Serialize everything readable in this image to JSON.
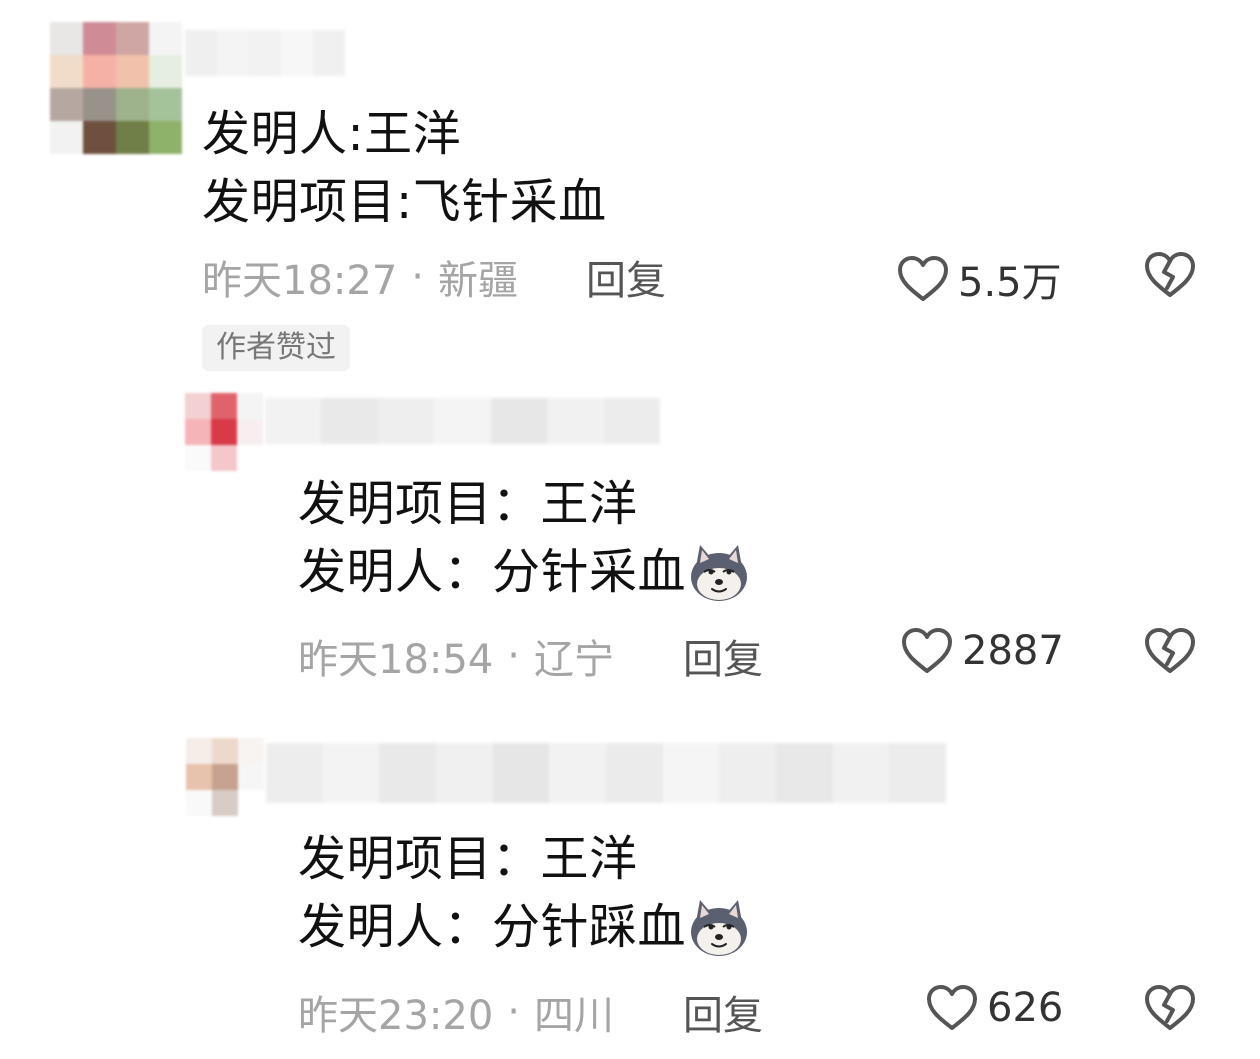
{
  "comments": [
    {
      "text_lines": [
        "发明人:王洋",
        "发明项目:飞针采血"
      ],
      "time": "昨天18:27",
      "location": "新疆",
      "separator": "·",
      "reply_label": "回复",
      "likes": "5.5万",
      "author_badge": "作者赞过",
      "avatar_colors": [
        "#e9e6e6",
        "#cf8c97",
        "#cfa6a3",
        "#f4f4f4",
        "#f1dcc9",
        "#f6b1a6",
        "#f1c2ab",
        "#e5eee0",
        "#b6a8a0",
        "#98928a",
        "#9eb28c",
        "#a4c39a",
        "#f2f2f2",
        "#6f503f",
        "#6f7f47",
        "#8fb26a"
      ],
      "name_colors": [
        "#efefef",
        "#f4f4f4",
        "#f2f2f2",
        "#f7f7f7",
        "#f0f0f0"
      ]
    },
    {
      "text_lines": [
        "发明项目：王洋",
        "发明人：分针采血"
      ],
      "time": "昨天18:54",
      "location": "辽宁",
      "separator": "·",
      "reply_label": "回复",
      "likes": "2887",
      "has_emoji": true,
      "emoji_icon": "doge-dog-emoji",
      "avatar_colors": [
        "#f3d0d2",
        "#e0626b",
        "#f4f4f4",
        "#f5b4b8",
        "#d83a48",
        "#f7efef",
        "#fafafa",
        "#f4c7cb",
        "#ffffff"
      ],
      "name_colors": [
        "#f2f2f2",
        "#e9e9e9",
        "#eeeeee",
        "#f4f4f4",
        "#e7e7e7",
        "#f1f1f1",
        "#ececec"
      ]
    },
    {
      "text_lines": [
        "发明项目：王洋",
        "发明人：分针踩血"
      ],
      "time": "昨天23:20",
      "location": "四川",
      "separator": "·",
      "reply_label": "回复",
      "likes": "626",
      "has_emoji": true,
      "emoji_icon": "doge-dog-emoji",
      "avatar_colors": [
        "#f5ede8",
        "#ecd9cc",
        "#f7f4f2",
        "#e7c2ac",
        "#c7a291",
        "#f6f6f6",
        "#f9f9f9",
        "#d7ccc6",
        "#ffffff"
      ],
      "name_colors": [
        "#ededed",
        "#f3f3f3",
        "#e9e9e9",
        "#f0f0f0",
        "#e6e6e6",
        "#f2f2f2",
        "#ebebeb",
        "#f5f5f5",
        "#eeeeee",
        "#e8e8e8",
        "#f1f1f1",
        "#ececec"
      ]
    }
  ],
  "icons": {
    "like": "heart-outline-icon",
    "dislike": "broken-heart-icon"
  },
  "colors": {
    "text": "#111111",
    "meta": "#a5a5a5",
    "reply": "#555555",
    "icon": "#555555",
    "badge_bg": "#f2f2f2"
  }
}
